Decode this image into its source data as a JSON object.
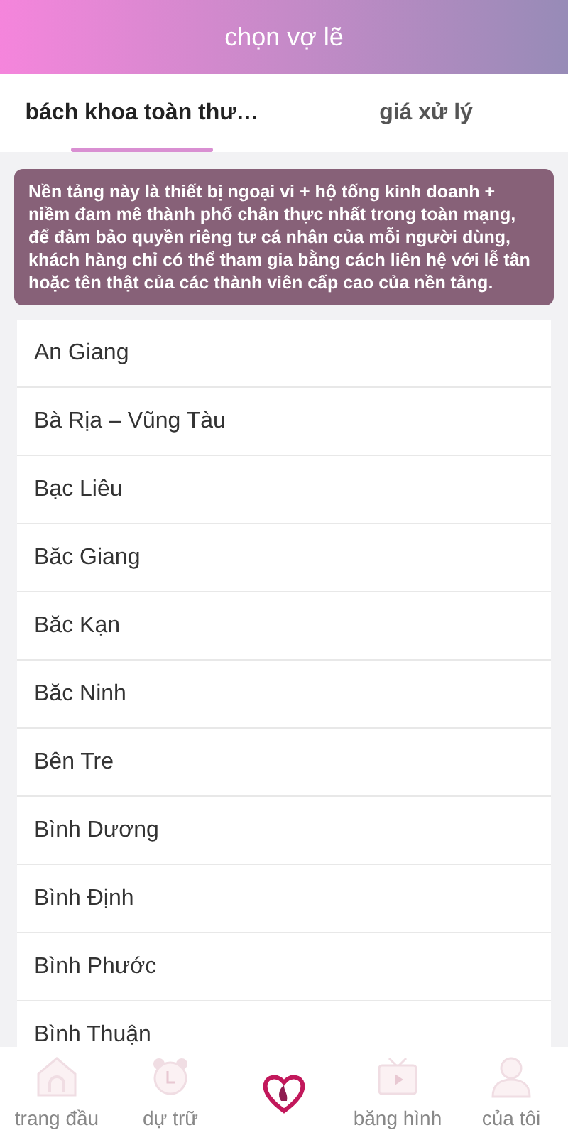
{
  "header": {
    "title": "chọn vợ lẽ"
  },
  "tabs": [
    {
      "label": "bách khoa toàn thư…",
      "selected": true
    },
    {
      "label": "giá xử lý",
      "selected": false
    }
  ],
  "notice": "Nền tảng này là thiết bị ngoại vi + hộ tống kinh doanh + niềm đam mê thành phố chân thực nhất trong toàn mạng, để đảm bảo quyền riêng tư cá nhân của mỗi người dùng, khách hàng chỉ có thể tham gia bằng cách liên hệ với lễ tân hoặc tên thật của các thành viên cấp cao của nền tảng.",
  "provinces": [
    "An Giang",
    "Bà Rịa – Vũng Tàu",
    "Bạc Liêu",
    "Băc Giang",
    "Băc Kạn",
    "Băc Ninh",
    "Bên Tre",
    "Bình Dương",
    "Bình Định",
    "Bình Phước",
    "Bình Thuận"
  ],
  "nav": [
    {
      "kind": "home",
      "label": "trang đầu"
    },
    {
      "kind": "clock",
      "label": "dự trữ"
    },
    {
      "kind": "logo"
    },
    {
      "kind": "tv",
      "label": "băng hình"
    },
    {
      "kind": "user",
      "label": "của tôi"
    }
  ]
}
